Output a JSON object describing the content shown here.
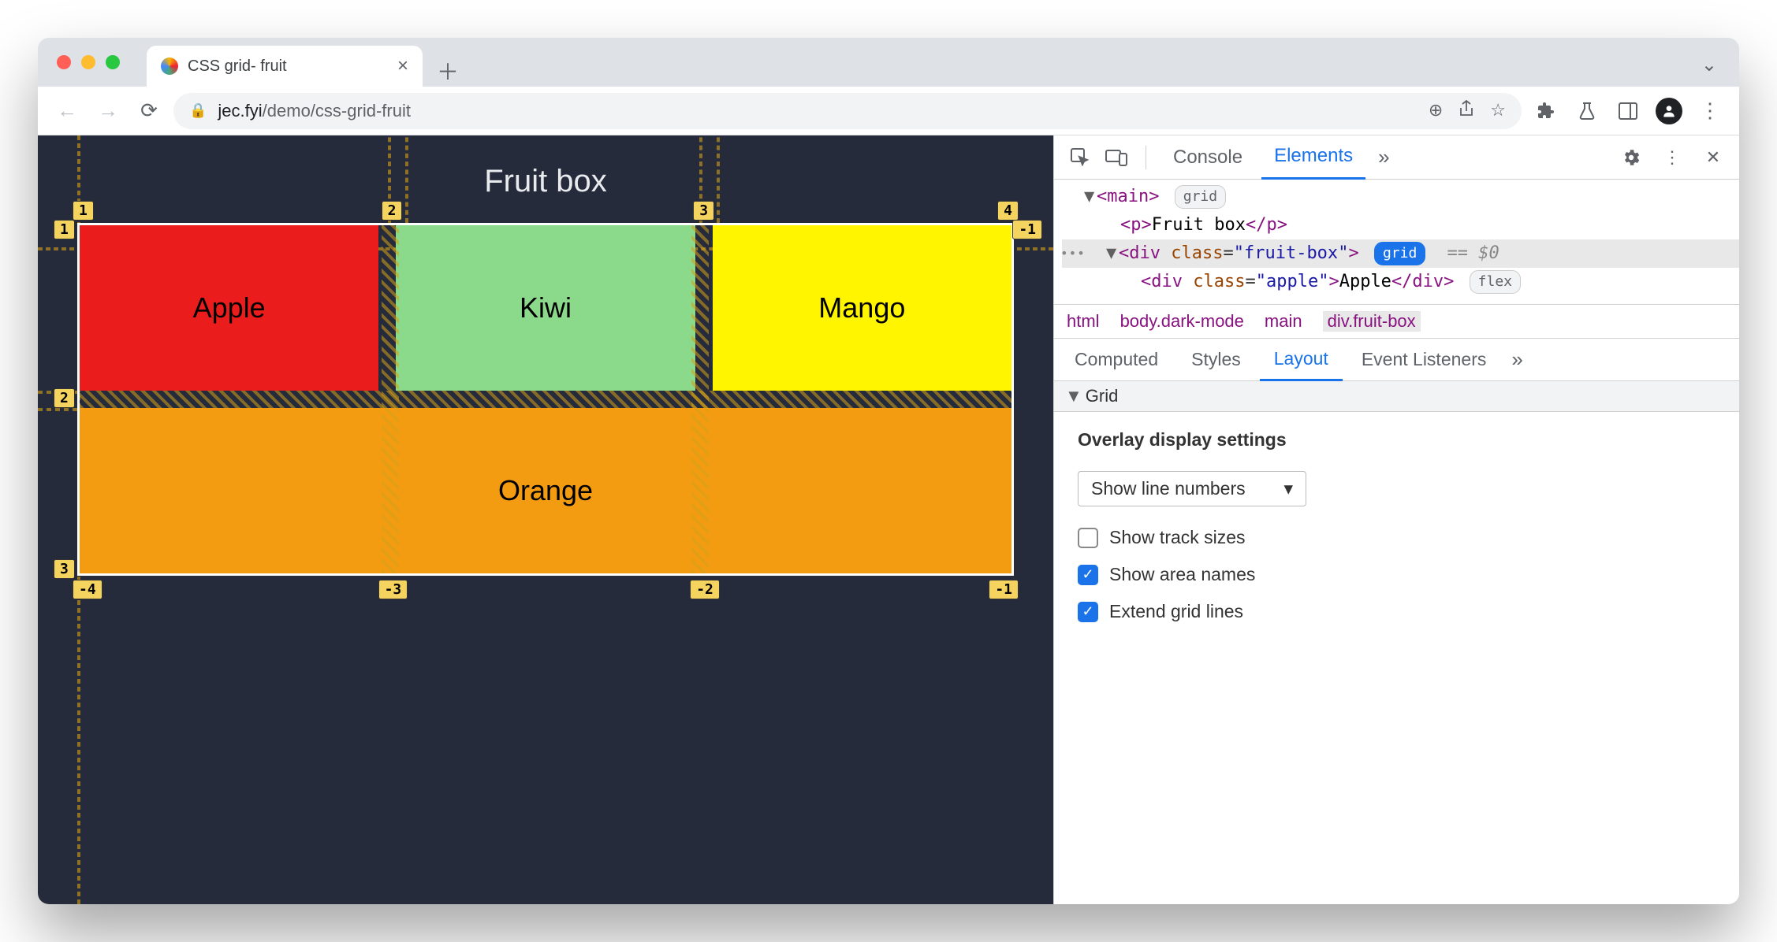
{
  "browser": {
    "tab_title": "CSS grid- fruit",
    "url_domain": "jec.fyi",
    "url_path": "/demo/css-grid-fruit"
  },
  "page": {
    "title": "Fruit box",
    "cells": {
      "apple": "Apple",
      "kiwi": "Kiwi",
      "mango": "Mango",
      "orange": "Orange"
    },
    "line_numbers_top": [
      "1",
      "2",
      "3",
      "4"
    ],
    "line_numbers_left": [
      "1",
      "2",
      "3"
    ],
    "line_numbers_right": [
      "-1"
    ],
    "line_numbers_bottom": [
      "-4",
      "-3",
      "-2",
      "-1"
    ]
  },
  "devtools": {
    "main_tabs": {
      "console": "Console",
      "elements": "Elements"
    },
    "tree": {
      "main_tag": "main",
      "grid_pill": "grid",
      "p_text": "Fruit box",
      "fruitbox_class": "fruit-box",
      "eq_zero": "== $0",
      "apple_class": "apple",
      "apple_text": "Apple",
      "flex_pill": "flex"
    },
    "breadcrumbs": [
      "html",
      "body.dark-mode",
      "main",
      "div.fruit-box"
    ],
    "style_tabs": {
      "computed": "Computed",
      "styles": "Styles",
      "layout": "Layout",
      "event": "Event Listeners"
    },
    "grid_section": "Grid",
    "layout": {
      "heading": "Overlay display settings",
      "select_label": "Show line numbers",
      "opt_track_sizes": "Show track sizes",
      "opt_area_names": "Show area names",
      "opt_extend_lines": "Extend grid lines"
    }
  }
}
